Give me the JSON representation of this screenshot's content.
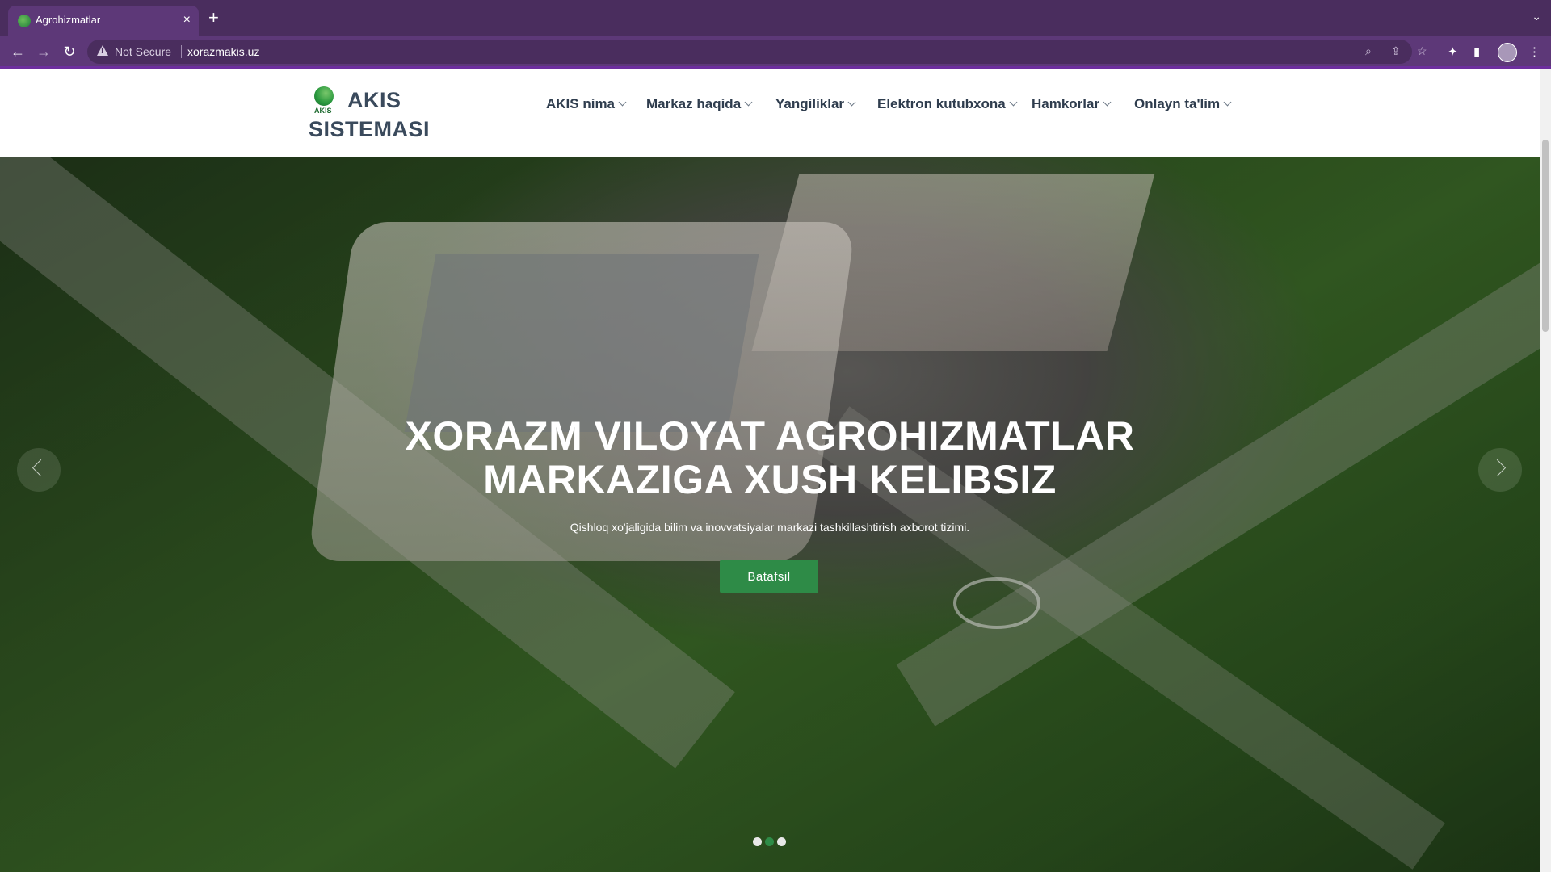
{
  "browser": {
    "tab_title": "Agrohizmatlar",
    "tab_close": "×",
    "new_tab": "+",
    "security_label": "Not Secure",
    "url": "xorazmakis.uz"
  },
  "site": {
    "logo": {
      "line1": "AKIS",
      "line2": "SISTEMASI",
      "small": "AKIS"
    },
    "menu": [
      {
        "label": "AKIS nima"
      },
      {
        "label": "Markaz haqida"
      },
      {
        "label": "Yangiliklar"
      },
      {
        "label": "Elektron kutubxona"
      },
      {
        "label": "Hamkorlar"
      },
      {
        "label": "Onlayn ta'lim"
      }
    ]
  },
  "hero": {
    "title_line1": "XORAZM VILOYAT AGROHIZMATLAR",
    "title_line2": "MARKAZIGA XUSH KELIBSIZ",
    "subtitle": "Qishloq xo'jaligida bilim va inovvatsiyalar markazi tashkillashtirish axborot tizimi.",
    "button": "Batafsil",
    "slides": 3,
    "active_slide": 2
  },
  "colors": {
    "browser_frame": "#5d3878",
    "accent_green": "#2e8b47",
    "nav_text": "#2f3d4e"
  }
}
